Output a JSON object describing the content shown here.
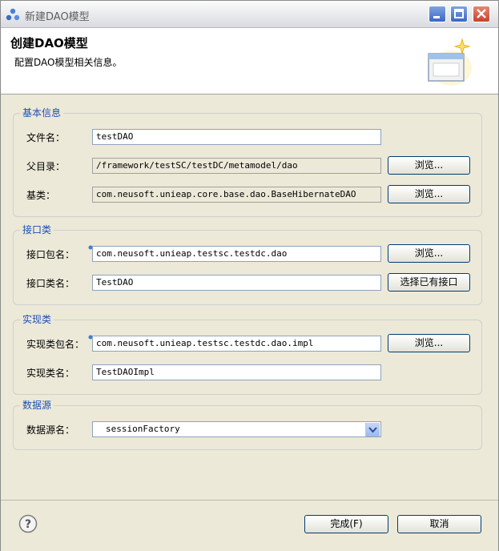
{
  "window": {
    "title": "新建DAO模型",
    "icon": "eclipse-app-icon"
  },
  "banner": {
    "title": "创建DAO模型",
    "description": "配置DAO模型相关信息。",
    "icon": "wizard-window-icon"
  },
  "groups": {
    "basic": {
      "title": "基本信息",
      "filename_label": "文件名：",
      "filename_value": "testDAO",
      "parent_label": "父目录：",
      "parent_value": "/framework/testSC/testDC/metamodel/dao",
      "parent_browse": "浏览...",
      "base_label": "基类：",
      "base_value": "com.neusoft.unieap.core.base.dao.BaseHibernateDAO",
      "base_browse": "浏览..."
    },
    "interface": {
      "title": "接口类",
      "package_label": "接口包名：",
      "package_value": "com.neusoft.unieap.testsc.testdc.dao",
      "package_browse": "浏览...",
      "class_label": "接口类名：",
      "class_value": "TestDAO",
      "select_existing": "选择已有接口"
    },
    "impl": {
      "title": "实现类",
      "package_label": "实现类包名：",
      "package_value": "com.neusoft.unieap.testsc.testdc.dao.impl",
      "package_browse": "浏览...",
      "class_label": "实现类名：",
      "class_value": "TestDAOImpl"
    },
    "datasource": {
      "title": "数据源",
      "name_label": "数据源名：",
      "name_value": "sessionFactory"
    }
  },
  "footer": {
    "finish": "完成(F)",
    "cancel": "取消"
  },
  "colors": {
    "group_title": "#1c4fb6",
    "dialog_bg": "#ece9d8",
    "close_button": "#c4442c"
  }
}
